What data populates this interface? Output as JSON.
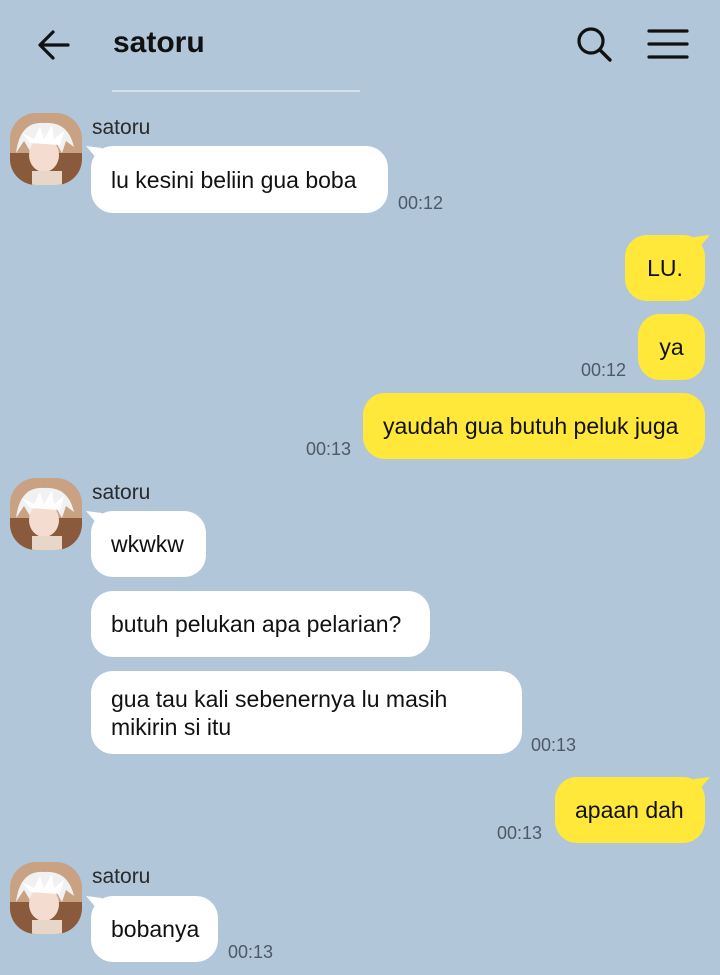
{
  "header": {
    "title": "satoru",
    "back_icon": "arrow-left-icon",
    "search_icon": "search-icon",
    "menu_icon": "hamburger-menu-icon"
  },
  "colors": {
    "background": "#b2c6da",
    "incoming_bubble": "#ffffff",
    "outgoing_bubble": "#ffe83a"
  },
  "messages": [
    {
      "direction": "in",
      "sender": "satoru",
      "text": "lu kesini beliin gua boba",
      "time": "00:12"
    },
    {
      "direction": "out",
      "text": "LU.",
      "time": ""
    },
    {
      "direction": "out",
      "text": "ya",
      "time": "00:12"
    },
    {
      "direction": "out",
      "text": "yaudah gua butuh peluk juga",
      "time": "00:13"
    },
    {
      "direction": "in",
      "sender": "satoru",
      "text": "wkwkw",
      "time": ""
    },
    {
      "direction": "in",
      "text": "butuh pelukan apa pelarian?",
      "time": ""
    },
    {
      "direction": "in",
      "text": "gua tau kali sebenernya lu masih mikirin si itu",
      "time": "00:13"
    },
    {
      "direction": "out",
      "text": "apaan dah",
      "time": "00:13"
    },
    {
      "direction": "in",
      "sender": "satoru",
      "text": "bobanya",
      "time": "00:13"
    }
  ]
}
